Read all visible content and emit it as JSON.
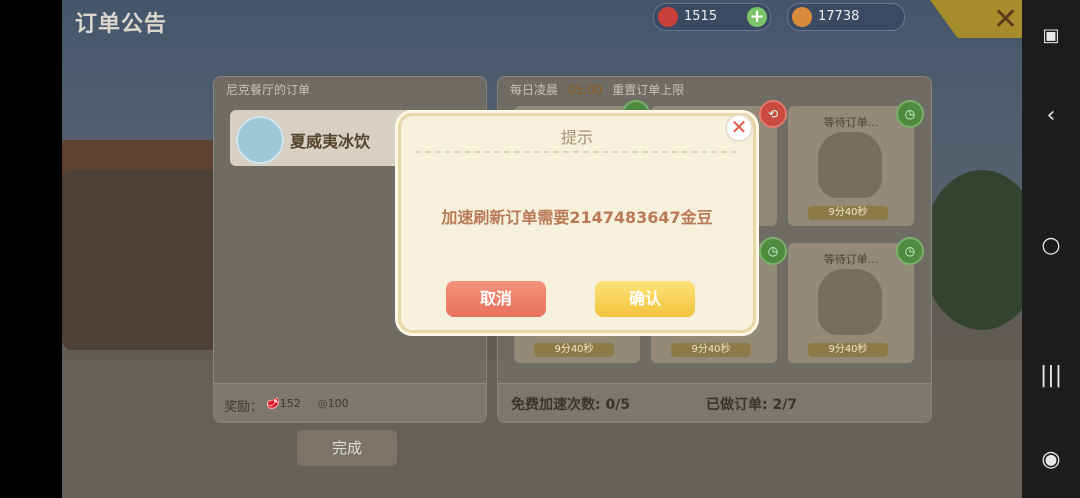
{
  "header": {
    "title": "订单公告",
    "currency_red": "1515",
    "currency_gold": "17738"
  },
  "left_panel": {
    "heading": "尼克餐厅的订单",
    "order_item": "夏威夷冰饮",
    "reward_label": "奖励：",
    "reward_a": "152",
    "reward_b": "100",
    "done_button": "完成"
  },
  "right_panel": {
    "heading_prefix": "每日凌晨",
    "heading_time": "05:00",
    "heading_suffix": "重置订单上限",
    "waiting_label": "等待订单...",
    "timers": [
      "9分40秒",
      "9分40秒",
      "9分40秒",
      "9分40秒"
    ],
    "free_speedups_label": "免费加速次数:",
    "free_speedups_value": "0/5",
    "orders_done_label": "已做订单:",
    "orders_done_value": "2/7"
  },
  "dialog": {
    "title": "提示",
    "message": "加速刷新订单需要2147483647金豆",
    "cancel": "取消",
    "confirm": "确认"
  },
  "colors": {
    "dialog_bg": "#f6f0dc",
    "cancel_btn": "#f08a72",
    "confirm_btn": "#f8d55a",
    "message_text": "#b97a56"
  }
}
